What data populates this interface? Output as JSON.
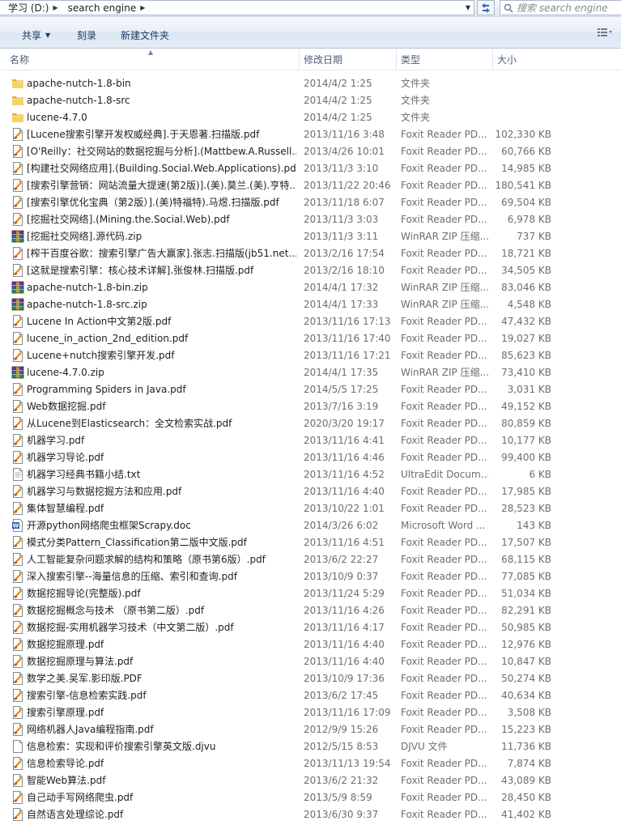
{
  "address": {
    "crumbs": [
      "学习 (D:)",
      "search engine"
    ],
    "search_placeholder": "搜索 search engine"
  },
  "toolbar": {
    "share_label": "共享",
    "burn_label": "刻录",
    "new_folder_label": "新建文件夹"
  },
  "columns": {
    "name": "名称",
    "date": "修改日期",
    "type": "类型",
    "size": "大小"
  },
  "files": [
    {
      "name": "apache-nutch-1.8-bin",
      "date": "2014/4/2 1:25",
      "type": "文件夹",
      "size": "",
      "icon": "folder-icon"
    },
    {
      "name": "apache-nutch-1.8-src",
      "date": "2014/4/2 1:25",
      "type": "文件夹",
      "size": "",
      "icon": "folder-icon"
    },
    {
      "name": "lucene-4.7.0",
      "date": "2014/4/2 1:25",
      "type": "文件夹",
      "size": "",
      "icon": "folder-icon"
    },
    {
      "name": "[Lucene搜索引擎开发权威经典].于天恩著.扫描版.pdf",
      "date": "2013/11/16 3:48",
      "type": "Foxit Reader PD...",
      "size": "102,330 KB",
      "icon": "pdf-icon"
    },
    {
      "name": "[O'Reilly：社交网站的数据挖掘与分析].(Mattbew.A.Russell...",
      "date": "2013/4/26 10:01",
      "type": "Foxit Reader PD...",
      "size": "60,766 KB",
      "icon": "pdf-icon"
    },
    {
      "name": "[构建社交网络应用].(Building.Social.Web.Applications).pdf",
      "date": "2013/11/3 3:10",
      "type": "Foxit Reader PD...",
      "size": "14,985 KB",
      "icon": "pdf-icon"
    },
    {
      "name": "[搜索引擎营销：网站流量大提速(第2版)].(美).莫兰.(美).亨特...",
      "date": "2013/11/22 20:46",
      "type": "Foxit Reader PD...",
      "size": "180,541 KB",
      "icon": "pdf-icon"
    },
    {
      "name": "[搜索引擎优化宝典（第2版）].(美)特福特).马煜.扫描版.pdf",
      "date": "2013/11/18 6:07",
      "type": "Foxit Reader PD...",
      "size": "69,504 KB",
      "icon": "pdf-icon"
    },
    {
      "name": "[挖掘社交网络].(Mining.the.Social.Web).pdf",
      "date": "2013/11/3 3:03",
      "type": "Foxit Reader PD...",
      "size": "6,978 KB",
      "icon": "pdf-icon"
    },
    {
      "name": "[挖掘社交网络].源代码.zip",
      "date": "2013/11/3 3:11",
      "type": "WinRAR ZIP 压缩...",
      "size": "737 KB",
      "icon": "zip-icon"
    },
    {
      "name": "[榨干百度谷歌：搜索引擎广告大赢家].张志.扫描版(jb51.net...",
      "date": "2013/2/16 17:54",
      "type": "Foxit Reader PD...",
      "size": "18,721 KB",
      "icon": "pdf-icon"
    },
    {
      "name": "[这就是搜索引擎：核心技术详解].张俊林.扫描版.pdf",
      "date": "2013/2/16 18:10",
      "type": "Foxit Reader PD...",
      "size": "34,505 KB",
      "icon": "pdf-icon"
    },
    {
      "name": "apache-nutch-1.8-bin.zip",
      "date": "2014/4/1 17:32",
      "type": "WinRAR ZIP 压缩...",
      "size": "83,046 KB",
      "icon": "zip-icon"
    },
    {
      "name": "apache-nutch-1.8-src.zip",
      "date": "2014/4/1 17:33",
      "type": "WinRAR ZIP 压缩...",
      "size": "4,548 KB",
      "icon": "zip-icon"
    },
    {
      "name": "Lucene In Action中文第2版.pdf",
      "date": "2013/11/16 17:13",
      "type": "Foxit Reader PD...",
      "size": "47,432 KB",
      "icon": "pdf-icon"
    },
    {
      "name": "lucene_in_action_2nd_edition.pdf",
      "date": "2013/11/16 17:40",
      "type": "Foxit Reader PD...",
      "size": "19,027 KB",
      "icon": "pdf-icon"
    },
    {
      "name": "Lucene+nutch搜索引擎开发.pdf",
      "date": "2013/11/16 17:21",
      "type": "Foxit Reader PD...",
      "size": "85,623 KB",
      "icon": "pdf-icon"
    },
    {
      "name": "lucene-4.7.0.zip",
      "date": "2014/4/1 17:35",
      "type": "WinRAR ZIP 压缩...",
      "size": "73,410 KB",
      "icon": "zip-icon"
    },
    {
      "name": "Programming Spiders in Java.pdf",
      "date": "2014/5/5 17:25",
      "type": "Foxit Reader PD...",
      "size": "3,031 KB",
      "icon": "pdf-icon"
    },
    {
      "name": "Web数据挖掘.pdf",
      "date": "2013/7/16 3:19",
      "type": "Foxit Reader PD...",
      "size": "49,152 KB",
      "icon": "pdf-icon"
    },
    {
      "name": "从Lucene到Elasticsearch：全文检索实战.pdf",
      "date": "2020/3/20 19:17",
      "type": "Foxit Reader PD...",
      "size": "80,859 KB",
      "icon": "pdf-icon"
    },
    {
      "name": "机器学习.pdf",
      "date": "2013/11/16 4:41",
      "type": "Foxit Reader PD...",
      "size": "10,177 KB",
      "icon": "pdf-icon"
    },
    {
      "name": "机器学习导论.pdf",
      "date": "2013/11/16 4:46",
      "type": "Foxit Reader PD...",
      "size": "99,400 KB",
      "icon": "pdf-icon"
    },
    {
      "name": "机器学习经典书籍小结.txt",
      "date": "2013/11/16 4:52",
      "type": "UltraEdit Docum...",
      "size": "6 KB",
      "icon": "txt-icon"
    },
    {
      "name": "机器学习与数据挖掘方法和应用.pdf",
      "date": "2013/11/16 4:40",
      "type": "Foxit Reader PD...",
      "size": "17,985 KB",
      "icon": "pdf-icon"
    },
    {
      "name": "集体智慧编程.pdf",
      "date": "2013/10/22 1:01",
      "type": "Foxit Reader PD...",
      "size": "28,523 KB",
      "icon": "pdf-icon"
    },
    {
      "name": "开源python网络爬虫框架Scrapy.doc",
      "date": "2014/3/26 6:02",
      "type": "Microsoft Word ...",
      "size": "143 KB",
      "icon": "word-icon"
    },
    {
      "name": "模式分类Pattern_Classification第二版中文版.pdf",
      "date": "2013/11/16 4:51",
      "type": "Foxit Reader PD...",
      "size": "17,507 KB",
      "icon": "pdf-icon"
    },
    {
      "name": "人工智能复杂问题求解的结构和策略（原书第6版）.pdf",
      "date": "2013/6/2 22:27",
      "type": "Foxit Reader PD...",
      "size": "68,115 KB",
      "icon": "pdf-icon"
    },
    {
      "name": "深入搜索引擎--海量信息的压缩、索引和查询.pdf",
      "date": "2013/10/9 0:37",
      "type": "Foxit Reader PD...",
      "size": "77,085 KB",
      "icon": "pdf-icon"
    },
    {
      "name": "数据挖掘导论(完整版).pdf",
      "date": "2013/11/24 5:29",
      "type": "Foxit Reader PD...",
      "size": "51,034 KB",
      "icon": "pdf-icon"
    },
    {
      "name": "数据挖掘概念与技术  （原书第二版）.pdf",
      "date": "2013/11/16 4:26",
      "type": "Foxit Reader PD...",
      "size": "82,291 KB",
      "icon": "pdf-icon"
    },
    {
      "name": "数据挖掘-实用机器学习技术（中文第二版）.pdf",
      "date": "2013/11/16 4:17",
      "type": "Foxit Reader PD...",
      "size": "50,985 KB",
      "icon": "pdf-icon"
    },
    {
      "name": "数据挖掘原理.pdf",
      "date": "2013/11/16 4:40",
      "type": "Foxit Reader PD...",
      "size": "12,976 KB",
      "icon": "pdf-icon"
    },
    {
      "name": "数据挖掘原理与算法.pdf",
      "date": "2013/11/16 4:40",
      "type": "Foxit Reader PD...",
      "size": "10,847 KB",
      "icon": "pdf-icon"
    },
    {
      "name": "数学之美.吴军.影印版.PDF",
      "date": "2013/10/9 17:36",
      "type": "Foxit Reader PD...",
      "size": "50,274 KB",
      "icon": "pdf-icon"
    },
    {
      "name": "搜索引擎-信息检索实践.pdf",
      "date": "2013/6/2 17:45",
      "type": "Foxit Reader PD...",
      "size": "40,634 KB",
      "icon": "pdf-icon"
    },
    {
      "name": "搜索引擎原理.pdf",
      "date": "2013/11/16 17:09",
      "type": "Foxit Reader PD...",
      "size": "3,508 KB",
      "icon": "pdf-icon"
    },
    {
      "name": "网络机器人Java编程指南.pdf",
      "date": "2012/9/9 15:26",
      "type": "Foxit Reader PD...",
      "size": "15,223 KB",
      "icon": "pdf-icon"
    },
    {
      "name": "信息检索：实现和评价搜索引擎英文版.djvu",
      "date": "2012/5/15 8:53",
      "type": "DJVU 文件",
      "size": "11,736 KB",
      "icon": "file-icon"
    },
    {
      "name": "信息检索导论.pdf",
      "date": "2013/11/13 19:54",
      "type": "Foxit Reader PD...",
      "size": "7,874 KB",
      "icon": "pdf-icon"
    },
    {
      "name": "智能Web算法.pdf",
      "date": "2013/6/2 21:32",
      "type": "Foxit Reader PD...",
      "size": "43,089 KB",
      "icon": "pdf-icon"
    },
    {
      "name": "自己动手写网络爬虫.pdf",
      "date": "2013/5/9 8:59",
      "type": "Foxit Reader PD...",
      "size": "28,450 KB",
      "icon": "pdf-icon"
    },
    {
      "name": "自然语言处理综论.pdf",
      "date": "2013/6/30 9:37",
      "type": "Foxit Reader PD...",
      "size": "41,402 KB",
      "icon": "pdf-icon"
    }
  ]
}
